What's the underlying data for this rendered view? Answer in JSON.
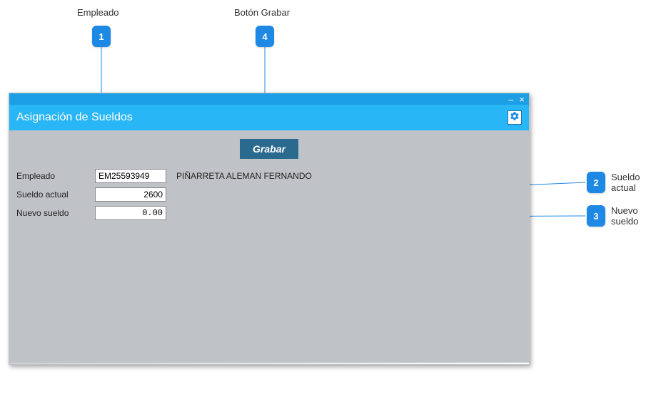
{
  "callouts": {
    "c1": {
      "num": "1",
      "label": "Empleado"
    },
    "c2": {
      "num": "2",
      "label": "Sueldo actual"
    },
    "c3": {
      "num": "3",
      "label": "Nuevo sueldo"
    },
    "c4": {
      "num": "4",
      "label": "Botón   Grabar"
    }
  },
  "window": {
    "title": "Asignación de Sueldos",
    "controls": {
      "minimize": "–",
      "close": "×"
    }
  },
  "toolbar": {
    "save_label": "Grabar"
  },
  "form": {
    "empleado_label": "Empleado",
    "empleado_value": "EM25593949",
    "empleado_name": "PIÑARRETA ALEMAN FERNANDO",
    "sueldo_actual_label": "Sueldo actual",
    "sueldo_actual_value": "2600",
    "nuevo_sueldo_label": "Nuevo sueldo",
    "nuevo_sueldo_value": "0.00"
  }
}
